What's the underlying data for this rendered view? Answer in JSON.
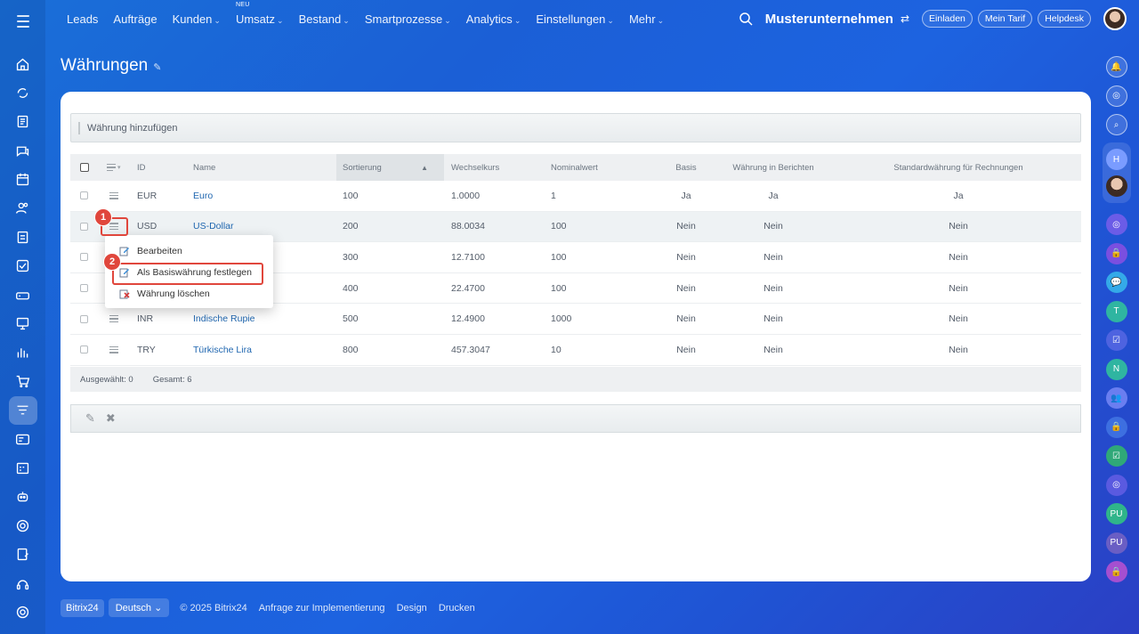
{
  "topnav": {
    "items": [
      {
        "label": "Leads",
        "chevron": false,
        "tag": ""
      },
      {
        "label": "Aufträge",
        "chevron": false,
        "tag": ""
      },
      {
        "label": "Kunden",
        "chevron": true,
        "tag": ""
      },
      {
        "label": "Umsatz",
        "chevron": true,
        "tag": "NEU"
      },
      {
        "label": "Bestand",
        "chevron": true,
        "tag": ""
      },
      {
        "label": "Smartprozesse",
        "chevron": true,
        "tag": ""
      },
      {
        "label": "Analytics",
        "chevron": true,
        "tag": ""
      },
      {
        "label": "Einstellungen",
        "chevron": true,
        "tag": ""
      },
      {
        "label": "Mehr",
        "chevron": true,
        "tag": ""
      }
    ],
    "company": "Musterunternehmen",
    "invite": "Einladen",
    "plan": "Mein Tarif",
    "helpdesk": "Helpdesk"
  },
  "page": {
    "title": "Währungen"
  },
  "toolbar": {
    "add_currency": "Währung hinzufügen"
  },
  "table": {
    "headers": {
      "id": "ID",
      "name": "Name",
      "sort": "Sortierung",
      "rate": "Wechselkurs",
      "nominal": "Nominalwert",
      "base": "Basis",
      "reports": "Währung in Berichten",
      "invoice": "Standardwährung für Rechnungen"
    },
    "rows": [
      {
        "id": "EUR",
        "name": "Euro",
        "sort": "100",
        "rate": "1.0000",
        "nominal": "1",
        "base": "Ja",
        "reports": "Ja",
        "invoice": "Ja"
      },
      {
        "id": "USD",
        "name": "US-Dollar",
        "sort": "200",
        "rate": "88.0034",
        "nominal": "100",
        "base": "Nein",
        "reports": "Nein",
        "invoice": "Nein"
      },
      {
        "id": "",
        "name": "",
        "sort": "300",
        "rate": "12.7100",
        "nominal": "100",
        "base": "Nein",
        "reports": "Nein",
        "invoice": "Nein"
      },
      {
        "id": "",
        "name": "",
        "sort": "400",
        "rate": "22.4700",
        "nominal": "100",
        "base": "Nein",
        "reports": "Nein",
        "invoice": "Nein"
      },
      {
        "id": "INR",
        "name": "Indische Rupie",
        "sort": "500",
        "rate": "12.4900",
        "nominal": "1000",
        "base": "Nein",
        "reports": "Nein",
        "invoice": "Nein"
      },
      {
        "id": "TRY",
        "name": "Türkische Lira",
        "sort": "800",
        "rate": "457.3047",
        "nominal": "10",
        "base": "Nein",
        "reports": "Nein",
        "invoice": "Nein"
      }
    ],
    "footer": {
      "selected": "Ausgewählt: 0",
      "total": "Gesamt: 6"
    }
  },
  "context_menu": {
    "edit": "Bearbeiten",
    "set_base": "Als Basiswährung festlegen",
    "delete": "Währung löschen"
  },
  "annotations": {
    "step1": "1",
    "step2": "2",
    "highlight_color": "#e0463c"
  },
  "rightbar": {
    "initials_h": "H",
    "initials_t": "T",
    "initials_n": "N",
    "initials_pu1": "PU",
    "initials_pu2": "PU"
  },
  "footer": {
    "brand": "Bitrix24",
    "language": "Deutsch",
    "copyright": "© 2025 Bitrix24",
    "implementation": "Anfrage zur Implementierung",
    "design": "Design",
    "print": "Drucken"
  },
  "colors": {
    "accent": "#2067b0",
    "background": "#1b5fd6"
  }
}
